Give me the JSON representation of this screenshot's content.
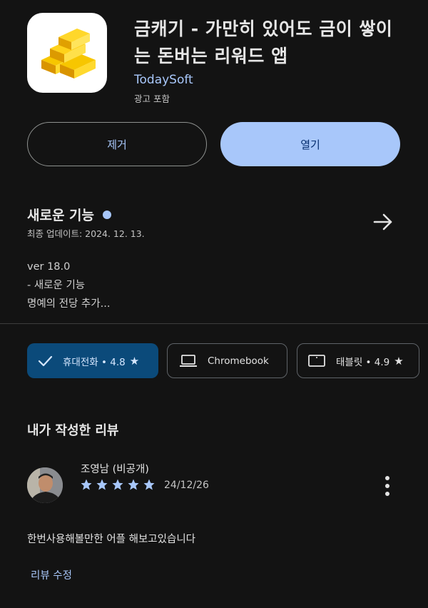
{
  "app": {
    "title": "금캐기 - 가만히 있어도 금이 쌓이는 돈버는 리워드 앱",
    "developer": "TodaySoft",
    "ad_notice": "광고 포함"
  },
  "actions": {
    "uninstall_label": "제거",
    "open_label": "열기"
  },
  "whats_new": {
    "title": "새로운 기능",
    "last_updated": "최종 업데이트: 2024. 12. 13.",
    "version": "ver 18.0",
    "line1": "- 새로운 기능",
    "line2": "명예의 전당 추가..."
  },
  "devices": [
    {
      "label": "휴대전화 • 4.8",
      "icon": "check-icon",
      "selected": true
    },
    {
      "label": "Chromebook",
      "icon": "laptop-icon",
      "selected": false
    },
    {
      "label": "태블릿 • 4.9",
      "icon": "tablet-icon",
      "selected": false
    }
  ],
  "my_review": {
    "heading": "내가 작성한 리뷰",
    "reviewer": "조영남 (비공개)",
    "rating": 5,
    "date": "24/12/26",
    "text": "한번사용해볼만한 어플 해보고있습니다",
    "edit_label": "리뷰 수정"
  },
  "colors": {
    "background": "#131313",
    "accent": "#a8c7fa",
    "selected_chip": "#0b4a7a",
    "open_button_text": "#062e6f"
  }
}
